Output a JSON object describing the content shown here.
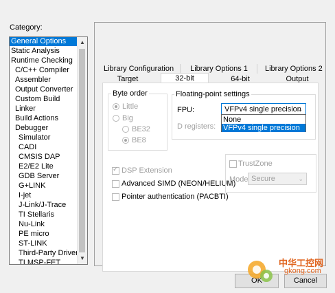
{
  "category": {
    "label": "Category:",
    "items": [
      "General Options",
      "Static Analysis",
      "Runtime Checking",
      "C/C++ Compiler",
      "Assembler",
      "Output Converter",
      "Custom Build",
      "Linker",
      "Build Actions",
      "Debugger",
      "Simulator",
      "CADI",
      "CMSIS DAP",
      "E2/E2 Lite",
      "GDB Server",
      "G+LINK",
      "I-jet",
      "J-Link/J-Trace",
      "TI Stellaris",
      "Nu-Link",
      "PE micro",
      "ST-LINK",
      "Third-Party Driver",
      "TI MSP-FET"
    ]
  },
  "tabs": {
    "row1": [
      "Library Configuration",
      "Library Options 1",
      "Library Options 2"
    ],
    "row2": [
      "Target",
      "32-bit",
      "64-bit",
      "Output"
    ]
  },
  "byte_order": {
    "title": "Byte order",
    "little": "Little",
    "big": "Big",
    "be32": "BE32",
    "be8": "BE8"
  },
  "fp": {
    "title": "Floating-point settings",
    "fpu_label": "FPU:",
    "fpu_value": "VFPv4 single precision",
    "options": [
      "None",
      "VFPv4 single precision"
    ],
    "dregs_label": "D registers:"
  },
  "dsp": "DSP Extension",
  "simd": "Advanced SIMD (NEON/HELIUM)",
  "pac": "Pointer authentication (PACBTI)",
  "trustzone": "TrustZone",
  "mode_label": "Mode:",
  "mode_value": "Secure",
  "ok": "OK",
  "cancel": "Cancel",
  "watermark": {
    "line1": "中华工控网",
    "line2": "gkong.com"
  }
}
